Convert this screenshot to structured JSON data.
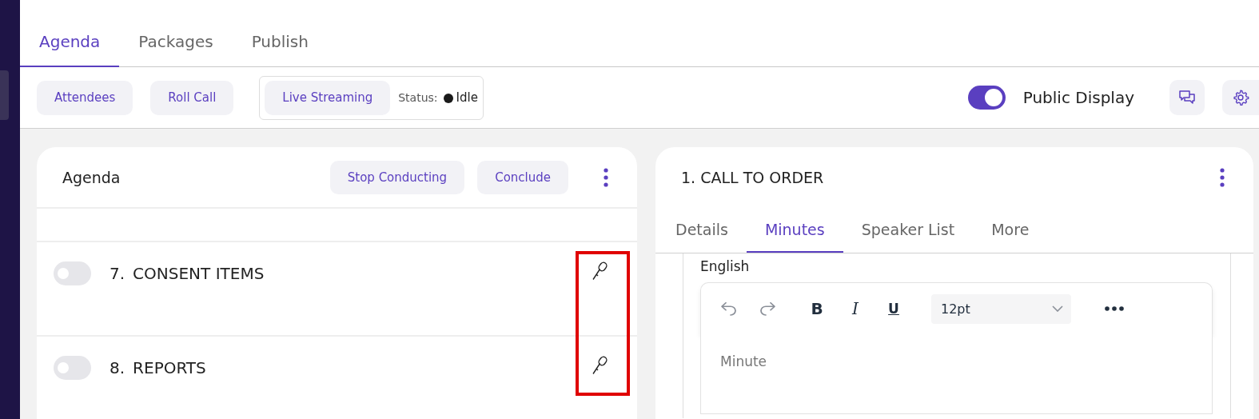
{
  "tabs": [
    {
      "label": "Agenda",
      "selected": true
    },
    {
      "label": "Packages",
      "selected": false
    },
    {
      "label": "Publish",
      "selected": false
    }
  ],
  "toolbar": {
    "buttons": [
      "Attendees",
      "Roll Call"
    ],
    "streaming": {
      "button": "Live Streaming",
      "status_label": "Status:",
      "status": "Idle",
      "color": "#1a1a1a"
    },
    "public_display": {
      "label": "Public Display",
      "on": true
    }
  },
  "agenda_panel": {
    "title": "Agenda",
    "buttons": [
      "Stop Conducting",
      "Conclude"
    ],
    "mic_column_highlighted": true,
    "items": [
      {
        "number": "7.",
        "title": "CONSENT ITEMS",
        "on": false
      },
      {
        "number": "8.",
        "title": "REPORTS",
        "on": false
      }
    ]
  },
  "detail_panel": {
    "title": "1. CALL TO ORDER",
    "tabs": [
      {
        "label": "Details",
        "selected": false
      },
      {
        "label": "Minutes",
        "selected": true
      },
      {
        "label": "Speaker List",
        "selected": false
      },
      {
        "label": "More",
        "selected": false
      }
    ],
    "language": "English",
    "editor": {
      "format_buttons": [
        {
          "label": "B",
          "kind": "bold"
        },
        {
          "label": "I",
          "kind": "italic"
        },
        {
          "label": "U",
          "kind": "underline"
        }
      ],
      "font_size": "12pt",
      "placeholder": "Minute"
    }
  }
}
